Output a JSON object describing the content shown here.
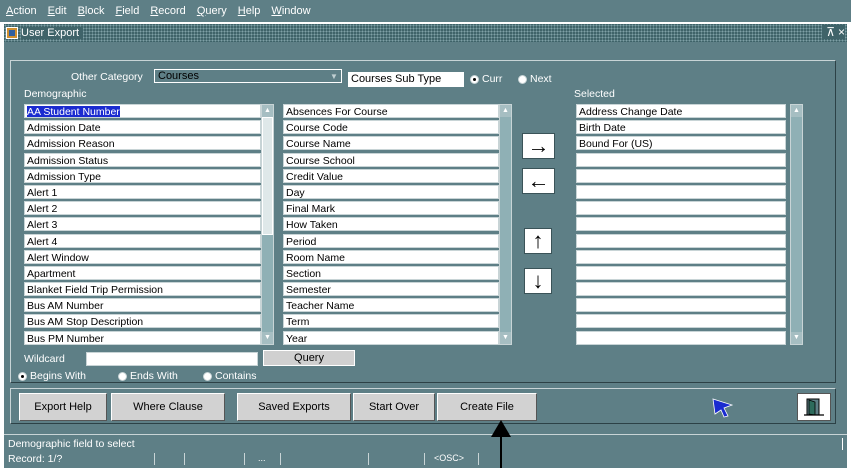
{
  "menu": [
    {
      "label_first": "A",
      "label_rest": "ction"
    },
    {
      "label_first": "E",
      "label_rest": "dit"
    },
    {
      "label_first": "B",
      "label_rest": "lock"
    },
    {
      "label_first": "F",
      "label_rest": "ield"
    },
    {
      "label_first": "R",
      "label_rest": "ecord"
    },
    {
      "label_first": "Q",
      "label_rest": "uery"
    },
    {
      "label_first": "H",
      "label_rest": "elp"
    },
    {
      "label_first": "W",
      "label_rest": "indow"
    }
  ],
  "window": {
    "title": "User Export",
    "controls": {
      "restore": "⊼",
      "close": "×"
    }
  },
  "filters": {
    "other_category_label": "Other Category",
    "other_category_value": "Courses",
    "sub_type_label": "Courses Sub Type",
    "sub_type_options": [
      "Curr",
      "Next"
    ],
    "sub_type_selected": "Curr"
  },
  "demographic": {
    "label": "Demographic",
    "items": [
      "AA Student Number",
      "Admission Date",
      "Admission Reason",
      "Admission Status",
      "Admission Type",
      "Alert 1",
      "Alert 2",
      "Alert 3",
      "Alert 4",
      "Alert Window",
      "Apartment",
      "Blanket Field Trip Permission",
      "Bus AM Number",
      "Bus AM Stop Description",
      "Bus PM Number"
    ],
    "selected_item": "AA Student Number"
  },
  "course_fields": {
    "items": [
      "Absences For Course",
      "Course Code",
      "Course Name",
      "Course School",
      "Credit Value",
      "Day",
      "Final Mark",
      "How Taken",
      "Period",
      "Room Name",
      "Section",
      "Semester",
      "Teacher Name",
      "Term",
      "Year"
    ]
  },
  "selected": {
    "label": "Selected",
    "items": [
      "Address Change Date",
      "Birth Date",
      "Bound For (US)",
      "",
      "",
      "",
      "",
      "",
      "",
      "",
      "",
      "",
      "",
      "",
      ""
    ]
  },
  "arrows": {
    "add": "→",
    "remove": "←",
    "move_up": "↑",
    "move_down": "↓"
  },
  "wildcard": {
    "label": "Wildcard",
    "value": "",
    "query_button": "Query",
    "match_options": [
      "Begins With",
      "Ends With",
      "Contains"
    ],
    "match_selected": "Begins With"
  },
  "buttons": {
    "export_help": "Export Help",
    "where_clause": "Where Clause",
    "saved_exports": "Saved Exports",
    "start_over": "Start Over",
    "create_file": "Create File"
  },
  "icons": {
    "pointer": "cursor-icon",
    "exit": "exit-door-icon"
  },
  "status": {
    "hint": "Demographic field to select",
    "record": "Record: 1/?",
    "mid_dots": "...",
    "mode": "<OSC>"
  },
  "colors": {
    "form_background": "#5e7f86",
    "title_bar": "#3f6369",
    "selection": "#1a2bd0",
    "pointer_icon": "#1a2bd0"
  }
}
